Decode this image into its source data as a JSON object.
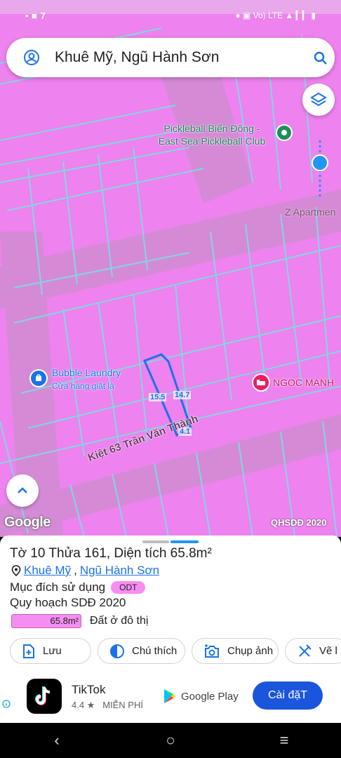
{
  "status_bar": {
    "time": "• ■ 7",
    "icons": "● ▣ Vo) LTE ▲ ▎▎ ▮"
  },
  "search": {
    "query": "Khuê Mỹ, Ngũ Hành Sơn"
  },
  "map": {
    "poi_pickleball": "Pickleball Biển Đông -\nEast Sea Pickleball Club",
    "poi_z_apartment": "Z Apartmen",
    "poi_laundry_name": "Bubble Laundry",
    "poi_laundry_sub": "Cửa hàng giặt là",
    "poi_hotel": "NGOC MANH",
    "street": "Kiệt 63 Trần Văn Thành",
    "dim_left": "15.5",
    "dim_right": "14.7",
    "dim_bottom": "4.1",
    "logo": "Google",
    "badge": "QHSDĐ 2020"
  },
  "parcel": {
    "title": "Tờ 10 Thửa 161, Diện tích 65.8m²",
    "ward": "Khuê Mỹ",
    "district": "Ngũ Hành Sơn",
    "separator": ",",
    "purpose_label": "Mục đích sử dụng",
    "purpose_code": "ODT",
    "plan_label": "Quy hoạch SDĐ 2020",
    "area_value": "65.8m²",
    "area_type": "Đất ở đô thị"
  },
  "actions": [
    {
      "label": "Lưu",
      "icon": "add-note-icon"
    },
    {
      "label": "Chú thích",
      "icon": "legend-icon"
    },
    {
      "label": "Chụp ảnh",
      "icon": "camera-icon"
    },
    {
      "label": "Vẽ l",
      "icon": "draw-icon"
    }
  ],
  "ad": {
    "app_name": "TikTok",
    "rating": "4.4 ★",
    "price": "MIỄN PHÍ",
    "store": "Google Play",
    "install": "Cài đặT"
  },
  "nav": {
    "back": "‹",
    "home": "○",
    "recents": "≡"
  },
  "colors": {
    "land": "#ee82ee",
    "road": "#d68fd6",
    "parcel_line": "#7fd8e0",
    "selection": "#1a73e8",
    "accent": "#1a56db"
  }
}
